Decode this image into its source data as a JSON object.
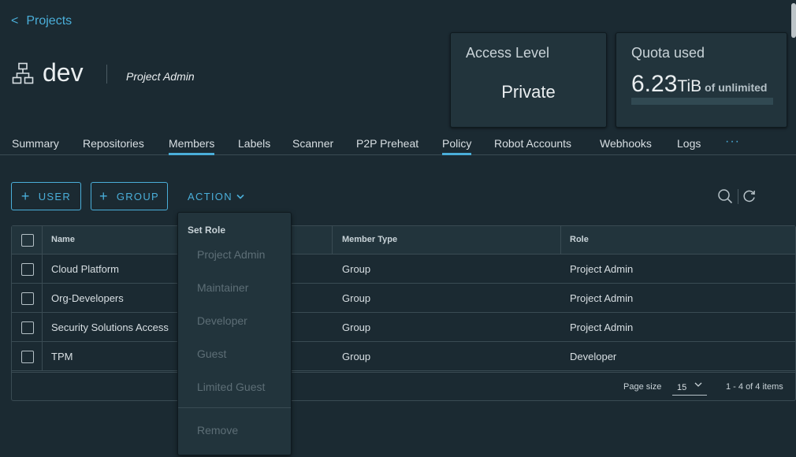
{
  "breadcrumb": {
    "chevron": "<",
    "label": "Projects"
  },
  "project": {
    "name": "dev",
    "role": "Project Admin",
    "icon": "project-tree-icon"
  },
  "access_card": {
    "title": "Access Level",
    "value": "Private"
  },
  "quota_card": {
    "title": "Quota used",
    "amount": "6.23",
    "unit": "TiB",
    "limit_text": "of unlimited",
    "fill_fraction": 0
  },
  "tabs": [
    {
      "label": "Summary",
      "active": false
    },
    {
      "label": "Repositories",
      "active": false
    },
    {
      "label": "Members",
      "active": true
    },
    {
      "label": "Labels",
      "active": false
    },
    {
      "label": "Scanner",
      "active": false
    },
    {
      "label": "P2P Preheat",
      "active": false
    },
    {
      "label": "Policy",
      "active": true
    },
    {
      "label": "Robot Accounts",
      "active": false
    },
    {
      "label": "Webhooks",
      "active": false
    },
    {
      "label": "Logs",
      "active": false
    }
  ],
  "tab_more": "···",
  "toolbar": {
    "add_user_plus": "+",
    "add_user_label": "USER",
    "add_group_plus": "+",
    "add_group_label": "GROUP",
    "action_label": "ACTION",
    "icons": [
      "search-icon",
      "refresh-icon",
      "chevron-down-icon"
    ]
  },
  "table": {
    "columns": [
      "Name",
      "Member Type",
      "Role"
    ],
    "rows": [
      {
        "name": "Cloud Platform",
        "type": "Group",
        "role": "Project Admin"
      },
      {
        "name": "Org-Developers",
        "type": "Group",
        "role": "Project Admin"
      },
      {
        "name": "Security Solutions Access",
        "type": "Group",
        "role": "Project Admin"
      },
      {
        "name": "TPM",
        "type": "Group",
        "role": "Developer"
      }
    ],
    "footer": {
      "page_size_label": "Page size",
      "page_size_value": "15",
      "count_text": "1 - 4 of 4 items"
    }
  },
  "action_menu": {
    "header": "Set Role",
    "items": [
      "Project Admin",
      "Maintainer",
      "Developer",
      "Guest",
      "Limited Guest"
    ],
    "remove": "Remove"
  },
  "colors": {
    "accent": "#4aaed9",
    "background": "#1b2a32",
    "panel": "#22343c",
    "disabled_text": "#5d6e76"
  }
}
